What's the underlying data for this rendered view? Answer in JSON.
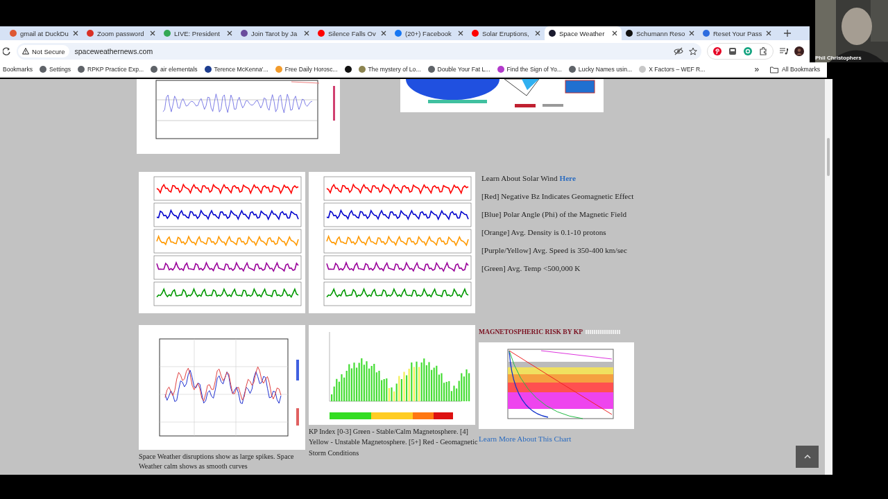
{
  "tabs": [
    {
      "label": "gmail at DuckDu",
      "color": "#de5833",
      "selected": false
    },
    {
      "label": "Zoom password",
      "color": "#d93025",
      "selected": false
    },
    {
      "label": "LIVE: President",
      "color": "#34a853",
      "selected": false
    },
    {
      "label": "Join Tarot by Ja",
      "color": "#6a4c9c",
      "selected": false
    },
    {
      "label": "Silence Falls Ov",
      "color": "#ff0000",
      "selected": false
    },
    {
      "label": "(20+) Facebook",
      "color": "#1877f2",
      "selected": false
    },
    {
      "label": "Solar Eruptions,",
      "color": "#ff0000",
      "selected": false
    },
    {
      "label": "Space Weather",
      "color": "#1a1a2e",
      "selected": true
    },
    {
      "label": "Schumann Reso",
      "color": "#111111",
      "selected": false
    },
    {
      "label": "Reset Your Pass",
      "color": "#2d6cdf",
      "selected": false
    }
  ],
  "address_bar": {
    "security": "Not Secure",
    "url": "spaceweathernews.com"
  },
  "webcam": {
    "name": "Phil Christophers"
  },
  "bookmarks": {
    "label": "Bookmarks",
    "items": [
      {
        "label": "Settings",
        "color": "#5f6368"
      },
      {
        "label": "RPKP Practice Exp...",
        "color": "#5f6368"
      },
      {
        "label": "air elementals",
        "color": "#5f6368"
      },
      {
        "label": "Terence McKenna'...",
        "color": "#1d3d8f"
      },
      {
        "label": "Free Daily Horosc...",
        "color": "#f29b2b"
      },
      {
        "color": "#111111"
      },
      {
        "label": "The mystery of Lo...",
        "color": "#8c8450"
      },
      {
        "label": "Double Your Fat L...",
        "color": "#5f6368"
      },
      {
        "label": "Find the Sign of Yo...",
        "color": "#b23acb"
      },
      {
        "label": "Lucky Names usin...",
        "color": "#5f6368"
      },
      {
        "label": "X Factors – WEF R...",
        "color": "#c8c8c8"
      }
    ],
    "overflow": "»",
    "all": "All Bookmarks"
  },
  "page": {
    "solar_wind": {
      "intro": "Learn About Solar Wind",
      "link": "Here",
      "notes": [
        "[Red] Negative Bz Indicates Geomagnetic Effect",
        "[Blue] Polar Angle (Phi) of the Magnetic Field",
        "[Orange] Avg. Density is 0.1-10 protons",
        "[Purple/Yellow] Avg. Speed is 350-400 km/sec",
        "[Green] Avg. Temp <500,000 K"
      ]
    },
    "magnetometer": {
      "caption": "Space Weather disruptions show as large spikes. Space Weather calm shows as smooth curves"
    },
    "kp_index": {
      "caption": "KP Index [0-3] Green - Stable/Calm Magnetosphere. [4] Yellow - Unstable Magnetosphere. [5+] Red - Geomagnetic Storm Conditions"
    },
    "risk": {
      "heading": "MAGNETOSPHERIC RISK BY KP",
      "link": "Learn More About This Chart"
    }
  }
}
